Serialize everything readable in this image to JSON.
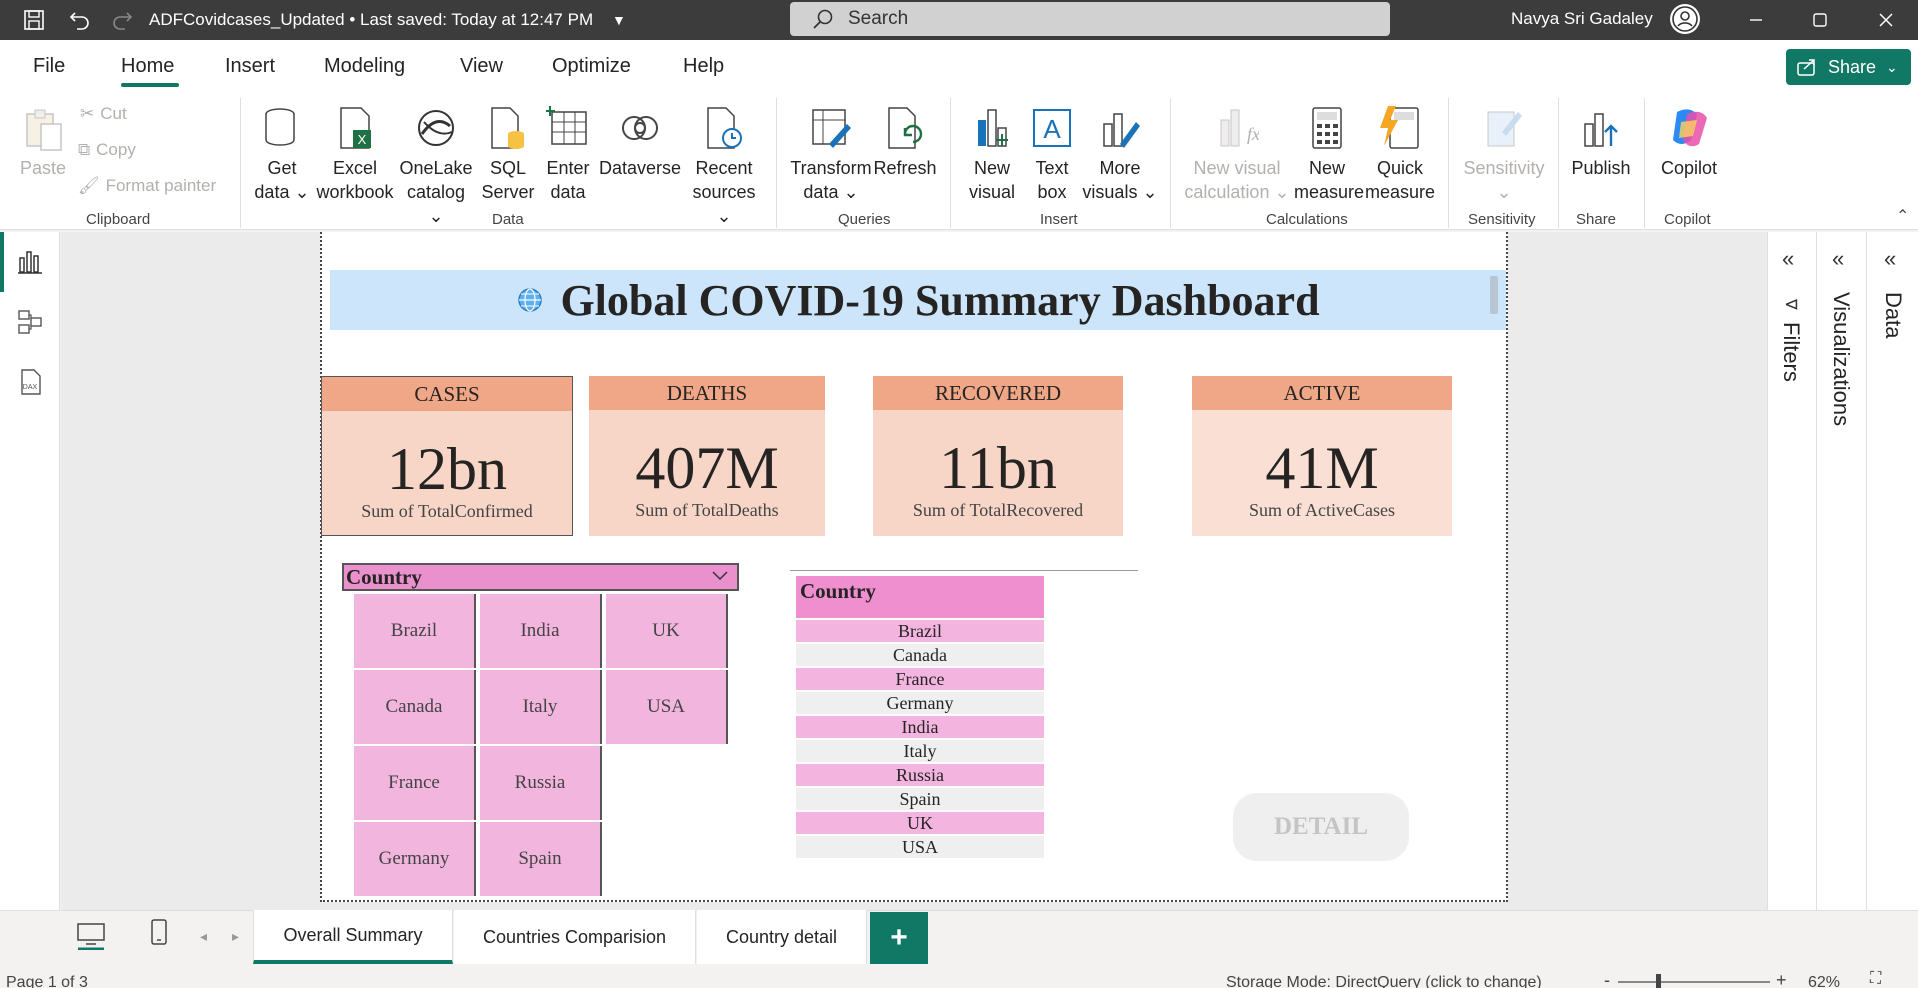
{
  "titlebar": {
    "doc_title": "ADFCovidcases_Updated • Last saved: Today at 12:47 PM",
    "search_placeholder": "Search",
    "user_name": "Navya Sri Gadaley"
  },
  "ribbon_tabs": [
    "File",
    "Home",
    "Insert",
    "Modeling",
    "View",
    "Optimize",
    "Help"
  ],
  "share_label": "Share",
  "clipboard": {
    "paste": "Paste",
    "cut": "Cut",
    "copy": "Copy",
    "format_painter": "Format painter",
    "group": "Clipboard"
  },
  "data_group": {
    "get_data": [
      "Get",
      "data"
    ],
    "excel": [
      "Excel",
      "workbook"
    ],
    "onelake": [
      "OneLake",
      "catalog"
    ],
    "sql": [
      "SQL",
      "Server"
    ],
    "enter": [
      "Enter",
      "data"
    ],
    "dataverse": "Dataverse",
    "recent": [
      "Recent",
      "sources"
    ],
    "group": "Data"
  },
  "queries_group": {
    "transform": [
      "Transform",
      "data"
    ],
    "refresh": "Refresh",
    "group": "Queries"
  },
  "insert_group": {
    "new_visual": [
      "New",
      "visual"
    ],
    "text_box": [
      "Text",
      "box"
    ],
    "more_visuals": [
      "More",
      "visuals"
    ],
    "group": "Insert"
  },
  "calc_group": {
    "new_visual_calc": [
      "New visual",
      "calculation"
    ],
    "new_measure": [
      "New",
      "measure"
    ],
    "quick_measure": [
      "Quick",
      "measure"
    ],
    "group": "Calculations"
  },
  "sensitivity_group": {
    "sensitivity": "Sensitivity",
    "group": "Sensitivity"
  },
  "share_group": {
    "publish": "Publish",
    "group": "Share"
  },
  "copilot_group": {
    "copilot": "Copilot",
    "group": "Copilot"
  },
  "dashboard": {
    "title": "Global COVID-19 Summary Dashboard",
    "cards": [
      {
        "header": "CASES",
        "value": "12bn",
        "label": "Sum of TotalConfirmed"
      },
      {
        "header": "DEATHS",
        "value": "407M",
        "label": "Sum of TotalDeaths"
      },
      {
        "header": "RECOVERED",
        "value": "11bn",
        "label": "Sum of TotalRecovered"
      },
      {
        "header": "ACTIVE",
        "value": "41M",
        "label": "Sum of ActiveCases"
      }
    ],
    "slicer": {
      "header": "Country",
      "tiles": [
        "Brazil",
        "India",
        "UK",
        "Canada",
        "Italy",
        "USA",
        "France",
        "Russia",
        "Germany",
        "Spain"
      ]
    },
    "table": {
      "header": "Country",
      "rows": [
        "Brazil",
        "Canada",
        "France",
        "Germany",
        "India",
        "Italy",
        "Russia",
        "Spain",
        "UK",
        "USA"
      ]
    },
    "detail_button": "DETAIL"
  },
  "right_panes": {
    "filters": "Filters",
    "visualizations": "Visualizations",
    "data": "Data"
  },
  "page_tabs": [
    "Overall Summary",
    "Countries Comparision",
    "Country detail"
  ],
  "status": {
    "page": "Page 1 of 3",
    "storage": "Storage Mode: DirectQuery (click to change)",
    "zoom": "62%"
  }
}
